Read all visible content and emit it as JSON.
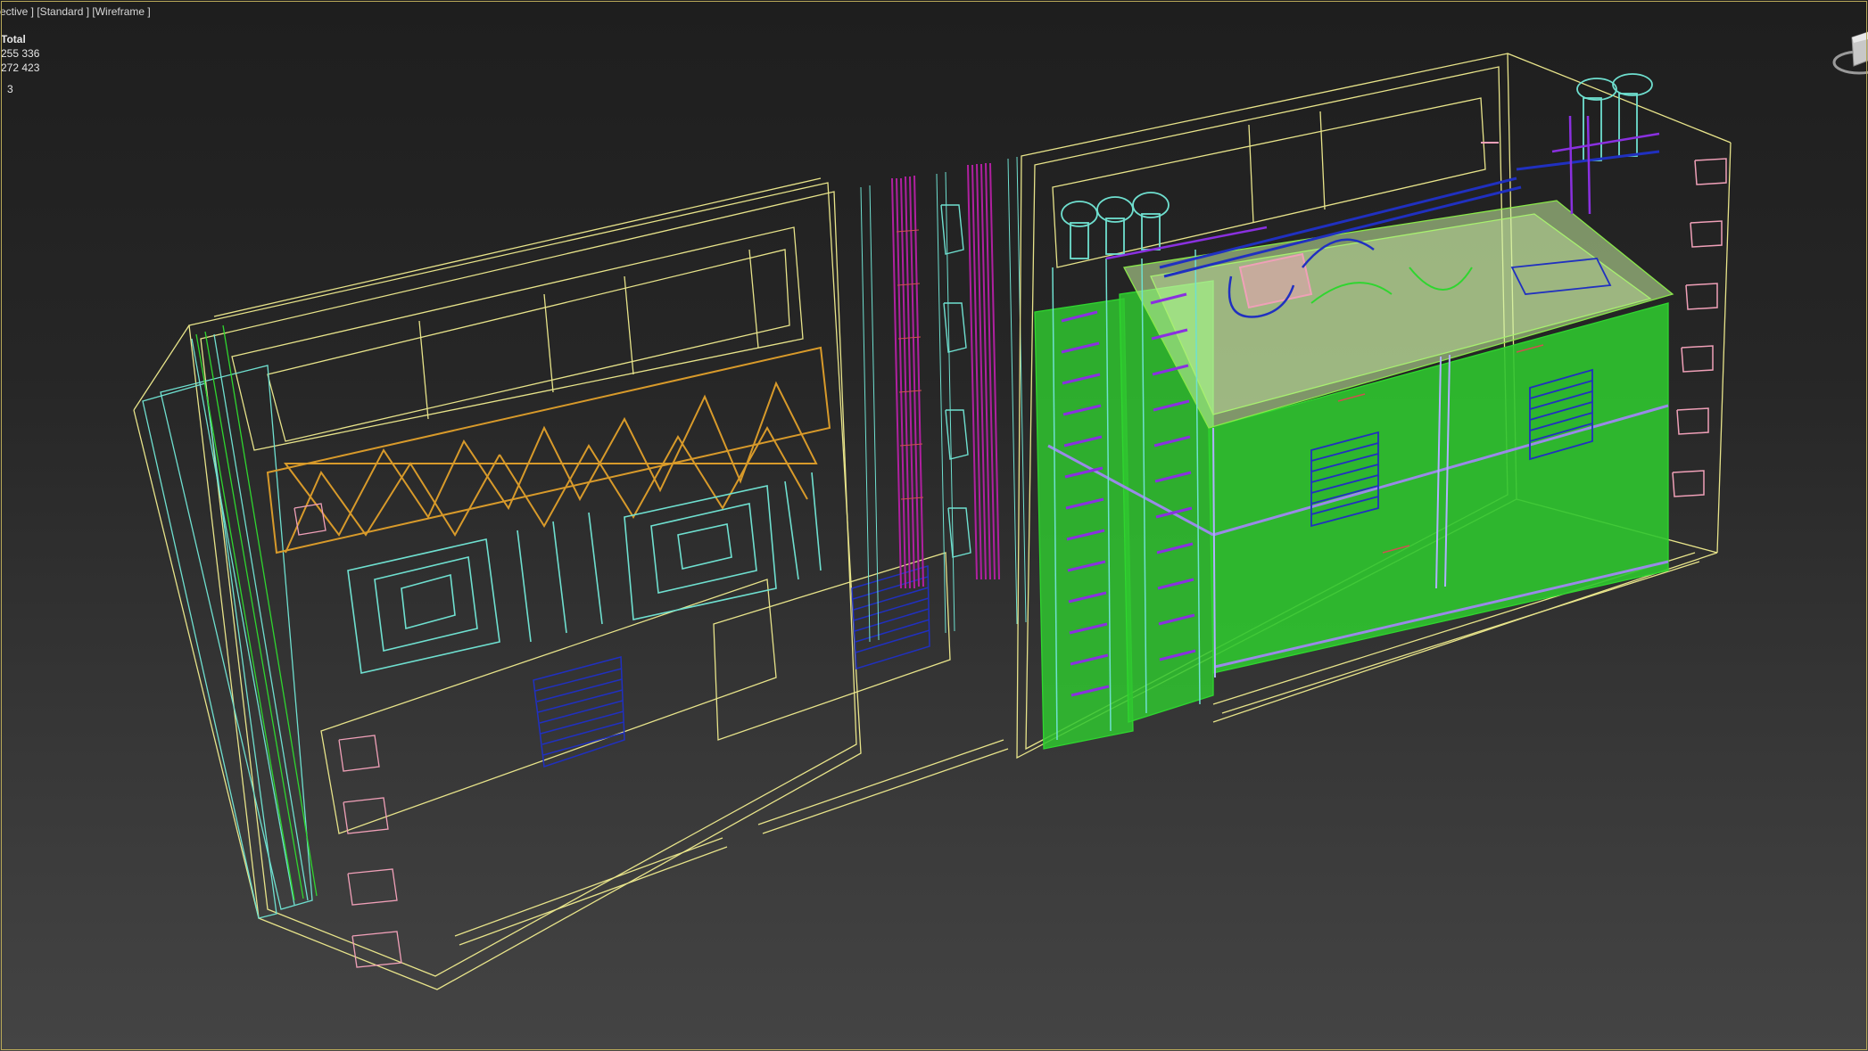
{
  "viewport": {
    "label": "ective ] [Standard ] [Wireframe ]"
  },
  "stats": {
    "title": "Total",
    "polys": "255 336",
    "verts": "272 423",
    "fps": "3"
  },
  "colors": {
    "frame_border": "#b8a858",
    "background_top": "#1e1e1e",
    "background_bottom": "#444444",
    "wire_yellow": "#e8e48a",
    "wire_cyan": "#6fe0d0",
    "wire_green": "#2fd62f",
    "wire_orange": "#d89a2a",
    "wire_magenta": "#b020a0",
    "wire_blue": "#2030c0",
    "wire_pink": "#f0a0b8"
  },
  "icons": {
    "view_gizmo": "viewcube-icon"
  }
}
